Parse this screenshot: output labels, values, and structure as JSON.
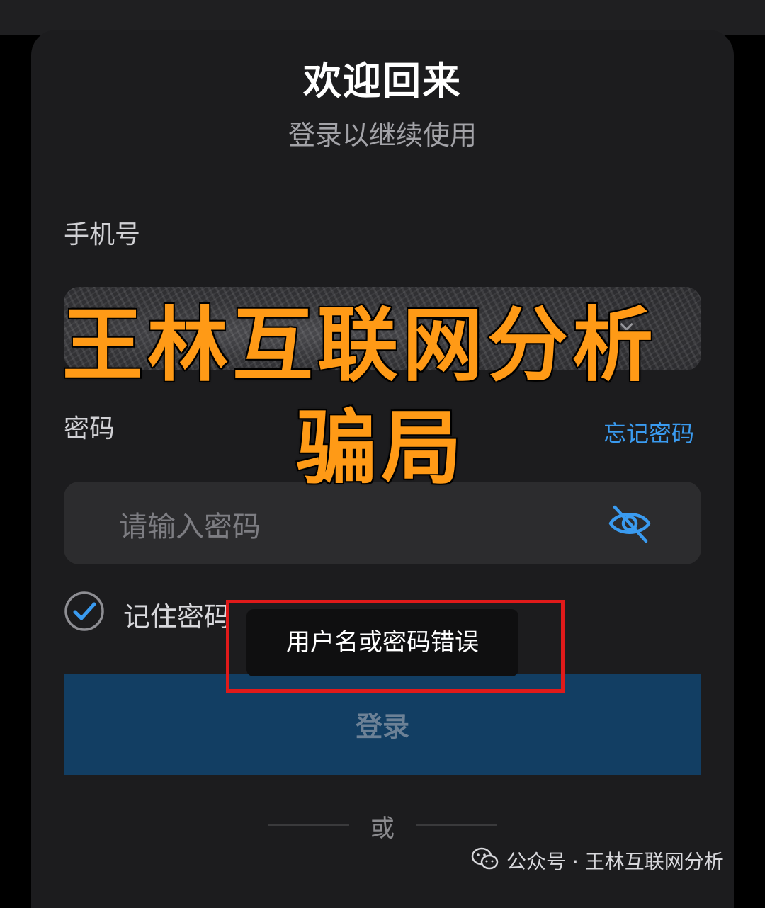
{
  "header": {
    "title": "欢迎回来",
    "subtitle": "登录以继续使用"
  },
  "form": {
    "phone_label": "手机号",
    "phone_clear_icon": "x-icon",
    "password_label": "密码",
    "forgot_password": "忘记密码",
    "password_placeholder": "请输入密码",
    "visibility_icon": "eye-off-icon",
    "remember_label": "记住密码",
    "remember_checked": true,
    "login_button": "登录",
    "divider_text": "或"
  },
  "toast": {
    "message": "用户名或密码错误"
  },
  "overlay": {
    "line1": "王林互联网分析",
    "line2": "骗局"
  },
  "watermark": {
    "text": "公众号 · 王林互联网分析",
    "icon": "wechat-icon"
  },
  "colors": {
    "accent": "#3a9bf0",
    "login_button_bg": "#123e63",
    "overlay_text": "#ff9a16",
    "highlight_border": "#e01a1a"
  }
}
